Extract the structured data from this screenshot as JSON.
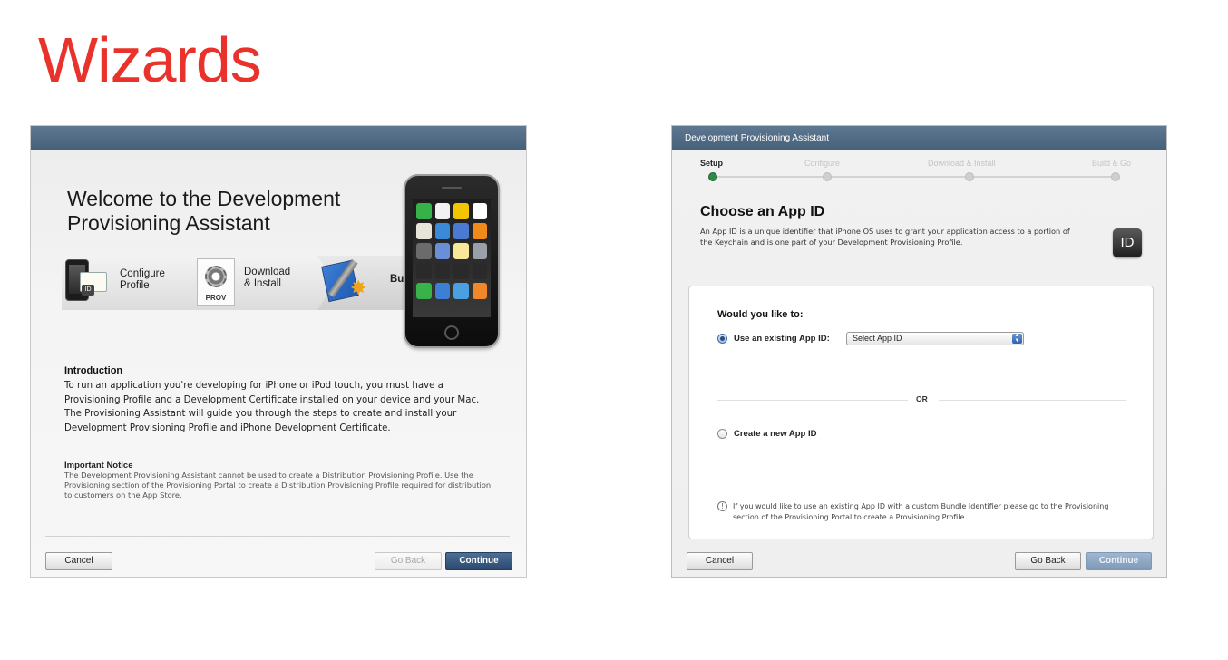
{
  "slide": {
    "title": "Wizards"
  },
  "welcome_wizard": {
    "heading": "Welcome to the Development Provisioning Assistant",
    "steps": [
      {
        "label": "Configure\nProfile",
        "icon": "iphone-certificate-icon"
      },
      {
        "label": "Download\n& Install",
        "icon": "provisioning-gear-icon",
        "icon_text": "PROV"
      },
      {
        "label": "Build & Go",
        "icon": "xcode-build-icon"
      }
    ],
    "id_badge": "ID",
    "intro_title": "Introduction",
    "intro_text": "To run an application you're developing for iPhone or iPod touch, you must have a Provisioning Profile and a Development Certificate installed on your device and your Mac. The Provisioning Assistant will guide you through the steps to create and install your Development Provisioning Profile and iPhone Development Certificate.",
    "notice_title": "Important Notice",
    "notice_text": "The Development Provisioning Assistant cannot be used to create a Distribution Provisioning Profile. Use the Provisioning section of the Provisioning Portal to create a Distribution Provisioning Profile required for distribution to customers on the App Store.",
    "buttons": {
      "cancel": "Cancel",
      "go_back": "Go Back",
      "continue": "Continue"
    },
    "colors": {
      "titlebar": "#46607a",
      "primary_button": "#2c4a6f"
    }
  },
  "app_id_wizard": {
    "window_title": "Development Provisioning Assistant",
    "progress_steps": [
      {
        "label": "Setup",
        "active": true
      },
      {
        "label": "Configure",
        "active": false
      },
      {
        "label": "Download & Install",
        "active": false
      },
      {
        "label": "Build & Go",
        "active": false
      }
    ],
    "heading": "Choose an App ID",
    "description": "An App ID is a unique identifier that iPhone OS uses to grant your application access to a portion of the Keychain and is one part of your Development Provisioning Profile.",
    "id_icon_text": "ID",
    "prompt": "Would you like to:",
    "option_existing": "Use an existing App ID:",
    "select_value": "Select App ID",
    "or_text": "OR",
    "option_new": "Create a new App ID",
    "info_text": "If you would like to use an existing App ID with a custom Bundle Identifier please go to the Provisioning section of the Provisioning Portal to create a Provisioning Profile.",
    "info_icon_text": "!",
    "buttons": {
      "cancel": "Cancel",
      "go_back": "Go Back",
      "continue": "Continue"
    },
    "colors": {
      "active_step_dot": "#2f8a46",
      "titlebar": "#46607a"
    }
  }
}
